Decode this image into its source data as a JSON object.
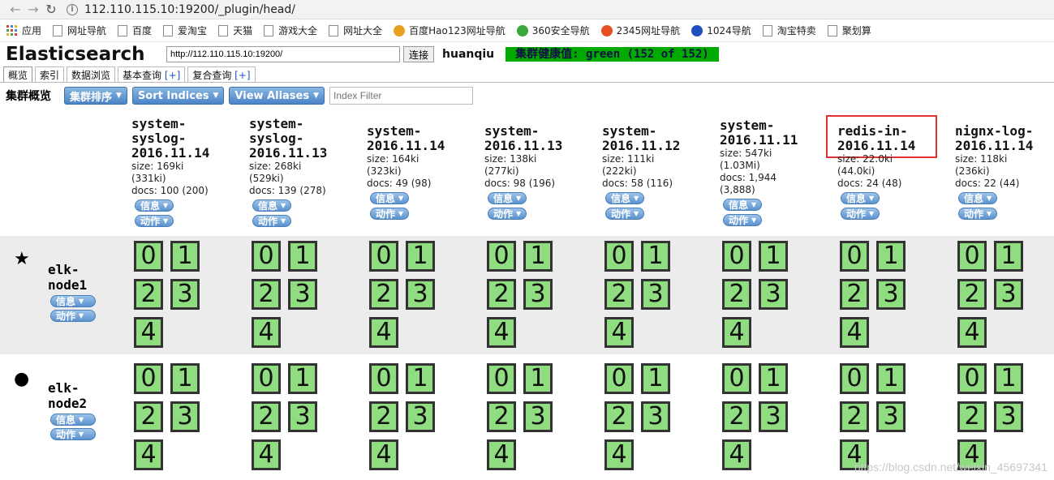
{
  "browser": {
    "url": "112.110.115.10:19200/_plugin/head/"
  },
  "bookmarks": [
    {
      "label": "应用",
      "icon": "apps-grid-icon"
    },
    {
      "label": "网址导航",
      "icon": "page-icon"
    },
    {
      "label": "百度",
      "icon": "page-icon"
    },
    {
      "label": "爱淘宝",
      "icon": "page-icon"
    },
    {
      "label": "天猫",
      "icon": "page-icon"
    },
    {
      "label": "游戏大全",
      "icon": "page-icon"
    },
    {
      "label": "网址大全",
      "icon": "page-icon"
    },
    {
      "label": "百度Hao123网址导航",
      "icon": "hao123-icon"
    },
    {
      "label": "360安全导航",
      "icon": "360-icon"
    },
    {
      "label": "2345网址导航",
      "icon": "2345-icon"
    },
    {
      "label": "1024导航",
      "icon": "1024-icon"
    },
    {
      "label": "淘宝特卖",
      "icon": "page-icon"
    },
    {
      "label": "聚划算",
      "icon": "page-icon"
    }
  ],
  "header": {
    "title": "Elasticsearch",
    "connect_url": "http://112.110.115.10:19200/",
    "connect_label": "连接",
    "cluster_name": "huanqiu",
    "health": "集群健康值: green (152 of 152)"
  },
  "tabs": [
    {
      "label": "概览",
      "plus": ""
    },
    {
      "label": "索引",
      "plus": ""
    },
    {
      "label": "数据浏览",
      "plus": ""
    },
    {
      "label": "基本查询",
      "plus": "[+]"
    },
    {
      "label": "复合查询",
      "plus": "[+]"
    }
  ],
  "toolbar": {
    "title": "集群概览",
    "sort_cluster": "集群排序",
    "sort_indices": "Sort Indices",
    "view_aliases": "View Aliases",
    "filter_placeholder": "Index Filter"
  },
  "pill_labels": {
    "info": "信息",
    "action": "动作"
  },
  "indices": [
    {
      "name": "system-\nsyslog-\n2016.11.14",
      "size": "size: 169ki",
      "size2": "(331ki)",
      "docs": "docs: 100 (200)",
      "docs2": ""
    },
    {
      "name": "system-\nsyslog-\n2016.11.13",
      "size": "size: 268ki",
      "size2": "(529ki)",
      "docs": "docs: 139 (278)",
      "docs2": ""
    },
    {
      "name": "system-\n2016.11.14",
      "size": "size: 164ki",
      "size2": "(323ki)",
      "docs": "docs: 49 (98)",
      "docs2": ""
    },
    {
      "name": "system-\n2016.11.13",
      "size": "size: 138ki",
      "size2": "(277ki)",
      "docs": "docs: 98 (196)",
      "docs2": ""
    },
    {
      "name": "system-\n2016.11.12",
      "size": "size: 111ki",
      "size2": "(222ki)",
      "docs": "docs: 58 (116)",
      "docs2": ""
    },
    {
      "name": "system-\n2016.11.11",
      "size": "size: 547ki",
      "size2": "(1.03Mi)",
      "docs": "docs: 1,944",
      "docs2": "(3,888)"
    },
    {
      "name": "redis-in-\n2016.11.14",
      "size": "size: 22.0ki",
      "size2": "(44.0ki)",
      "docs": "docs: 24 (48)",
      "docs2": ""
    },
    {
      "name": "nignx-log-\n2016.11.14",
      "size": "size: 118ki",
      "size2": "(236ki)",
      "docs": "docs: 22 (44)",
      "docs2": ""
    }
  ],
  "nodes": [
    {
      "name": "elk-\nnode1",
      "marker": "★",
      "marker_icon": "star-icon"
    },
    {
      "name": "elk-\nnode2",
      "marker": "●",
      "marker_icon": "circle-icon"
    }
  ],
  "shard_labels": [
    "0",
    "1",
    "2",
    "3",
    "4"
  ],
  "watermark": "https://blog.csdn.net/weixin_45697341",
  "colors": {
    "shard_fill": "#90dc80",
    "health_bg": "#00aa00",
    "highlight": "#e03030"
  }
}
